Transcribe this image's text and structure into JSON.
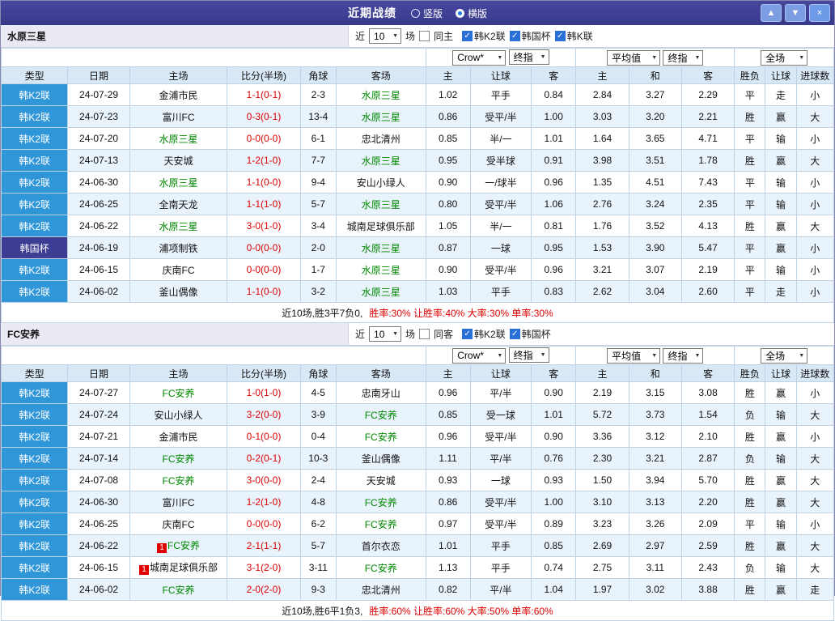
{
  "icons": {
    "chevron_down": "▼",
    "up_arrow": "▲",
    "down_arrow": "▼",
    "close": "×",
    "check": "✓"
  },
  "colors": {
    "win": "#dd0000",
    "draw": "#008800",
    "loss": "#1111cc",
    "k2": "#2f96d8",
    "cup": "#3d3d94",
    "focus": "#008800",
    "score": "#dd0000"
  },
  "result_color_map": {
    "胜": "win",
    "赢": "win",
    "大": "win",
    "平": "draw",
    "走": "draw",
    "负": "loss",
    "输": "loss",
    "小": "loss"
  },
  "titlebar": {
    "title": "近期战绩",
    "radios": [
      {
        "label": "竖版",
        "selected": false
      },
      {
        "label": "横版",
        "selected": true
      }
    ]
  },
  "table_header": {
    "left_columns": [
      "类型",
      "日期",
      "主场",
      "比分(半场)",
      "角球",
      "客场"
    ],
    "asia_sub": [
      "主",
      "让球",
      "客"
    ],
    "euro_sub": [
      "主",
      "和",
      "客"
    ],
    "result_sub": [
      "胜负",
      "让球",
      "进球数"
    ]
  },
  "sections": [
    {
      "team": "水原三星",
      "filters": {
        "near": "近",
        "count": "10",
        "games": "场",
        "same": {
          "label": "同主",
          "checked": false
        },
        "leagues": [
          {
            "label": "韩K2联",
            "checked": true
          },
          {
            "label": "韩国杯",
            "checked": true
          },
          {
            "label": "韩K联",
            "checked": true
          }
        ]
      },
      "dropdowns": {
        "asia_company": "Crow*",
        "asia_time": "终指",
        "euro_company": "平均值",
        "euro_time": "终指",
        "scope": "全场"
      },
      "rows": [
        {
          "league": "韩K2联",
          "date": "24-07-29",
          "home": "金浦市民",
          "home_focus": false,
          "score": "1-1(0-1)",
          "corner": "2-3",
          "away": "水原三星",
          "away_focus": true,
          "asia_home": "1.02",
          "handicap": "平手",
          "asia_away": "0.84",
          "euro_home": "2.84",
          "euro_draw": "3.27",
          "euro_away": "2.29",
          "result": "平",
          "handicap_result": "走",
          "goals": "小"
        },
        {
          "league": "韩K2联",
          "date": "24-07-23",
          "home": "富川FC",
          "home_focus": false,
          "score": "0-3(0-1)",
          "corner": "13-4",
          "away": "水原三星",
          "away_focus": true,
          "asia_home": "0.86",
          "handicap": "受平/半",
          "asia_away": "1.00",
          "euro_home": "3.03",
          "euro_draw": "3.20",
          "euro_away": "2.21",
          "result": "胜",
          "handicap_result": "赢",
          "goals": "大"
        },
        {
          "league": "韩K2联",
          "date": "24-07-20",
          "home": "水原三星",
          "home_focus": true,
          "score": "0-0(0-0)",
          "corner": "6-1",
          "away": "忠北清州",
          "away_focus": false,
          "asia_home": "0.85",
          "handicap": "半/一",
          "asia_away": "1.01",
          "euro_home": "1.64",
          "euro_draw": "3.65",
          "euro_away": "4.71",
          "result": "平",
          "handicap_result": "输",
          "goals": "小"
        },
        {
          "league": "韩K2联",
          "date": "24-07-13",
          "home": "天安城",
          "home_focus": false,
          "score": "1-2(1-0)",
          "corner": "7-7",
          "away": "水原三星",
          "away_focus": true,
          "asia_home": "0.95",
          "handicap": "受半球",
          "asia_away": "0.91",
          "euro_home": "3.98",
          "euro_draw": "3.51",
          "euro_away": "1.78",
          "result": "胜",
          "handicap_result": "赢",
          "goals": "大"
        },
        {
          "league": "韩K2联",
          "date": "24-06-30",
          "home": "水原三星",
          "home_focus": true,
          "score": "1-1(0-0)",
          "corner": "9-4",
          "away": "安山小绿人",
          "away_focus": false,
          "asia_home": "0.90",
          "handicap": "一/球半",
          "asia_away": "0.96",
          "euro_home": "1.35",
          "euro_draw": "4.51",
          "euro_away": "7.43",
          "result": "平",
          "handicap_result": "输",
          "goals": "小"
        },
        {
          "league": "韩K2联",
          "date": "24-06-25",
          "home": "全南天龙",
          "home_focus": false,
          "score": "1-1(1-0)",
          "corner": "5-7",
          "away": "水原三星",
          "away_focus": true,
          "asia_home": "0.80",
          "handicap": "受平/半",
          "asia_away": "1.06",
          "euro_home": "2.76",
          "euro_draw": "3.24",
          "euro_away": "2.35",
          "result": "平",
          "handicap_result": "输",
          "goals": "小"
        },
        {
          "league": "韩K2联",
          "date": "24-06-22",
          "home": "水原三星",
          "home_focus": true,
          "score": "3-0(1-0)",
          "corner": "3-4",
          "away": "城南足球俱乐部",
          "away_focus": false,
          "asia_home": "1.05",
          "handicap": "半/一",
          "asia_away": "0.81",
          "euro_home": "1.76",
          "euro_draw": "3.52",
          "euro_away": "4.13",
          "result": "胜",
          "handicap_result": "赢",
          "goals": "大"
        },
        {
          "league": "韩国杯",
          "is_cup": true,
          "date": "24-06-19",
          "home": "浦项制铁",
          "home_focus": false,
          "score": "0-0(0-0)",
          "corner": "2-0",
          "away": "水原三星",
          "away_focus": true,
          "asia_home": "0.87",
          "handicap": "一球",
          "asia_away": "0.95",
          "euro_home": "1.53",
          "euro_draw": "3.90",
          "euro_away": "5.47",
          "result": "平",
          "handicap_result": "赢",
          "goals": "小"
        },
        {
          "league": "韩K2联",
          "date": "24-06-15",
          "home": "庆南FC",
          "home_focus": false,
          "score": "0-0(0-0)",
          "corner": "1-7",
          "away": "水原三星",
          "away_focus": true,
          "asia_home": "0.90",
          "handicap": "受平/半",
          "asia_away": "0.96",
          "euro_home": "3.21",
          "euro_draw": "3.07",
          "euro_away": "2.19",
          "result": "平",
          "handicap_result": "输",
          "goals": "小"
        },
        {
          "league": "韩K2联",
          "date": "24-06-02",
          "home": "釜山偶像",
          "home_focus": false,
          "score": "1-1(0-0)",
          "corner": "3-2",
          "away": "水原三星",
          "away_focus": true,
          "asia_home": "1.03",
          "handicap": "平手",
          "asia_away": "0.83",
          "euro_home": "2.62",
          "euro_draw": "3.04",
          "euro_away": "2.60",
          "result": "平",
          "handicap_result": "走",
          "goals": "小"
        }
      ],
      "summary": {
        "record": "近10场,胜3平7负0,",
        "rates": "胜率:30% 让胜率:40% 大率:30% 单率:30%"
      }
    },
    {
      "team": "FC安养",
      "filters": {
        "near": "近",
        "count": "10",
        "games": "场",
        "same": {
          "label": "同客",
          "checked": false
        },
        "leagues": [
          {
            "label": "韩K2联",
            "checked": true
          },
          {
            "label": "韩国杯",
            "checked": true
          }
        ]
      },
      "dropdowns": {
        "asia_company": "Crow*",
        "asia_time": "终指",
        "euro_company": "平均值",
        "euro_time": "终指",
        "scope": "全场"
      },
      "rows": [
        {
          "league": "韩K2联",
          "date": "24-07-27",
          "home": "FC安养",
          "home_focus": true,
          "score": "1-0(1-0)",
          "corner": "4-5",
          "away": "忠南牙山",
          "away_focus": false,
          "asia_home": "0.96",
          "handicap": "平/半",
          "asia_away": "0.90",
          "euro_home": "2.19",
          "euro_draw": "3.15",
          "euro_away": "3.08",
          "result": "胜",
          "handicap_result": "赢",
          "goals": "小"
        },
        {
          "league": "韩K2联",
          "date": "24-07-24",
          "home": "安山小绿人",
          "home_focus": false,
          "score": "3-2(0-0)",
          "corner": "3-9",
          "away": "FC安养",
          "away_focus": true,
          "asia_home": "0.85",
          "handicap": "受一球",
          "asia_away": "1.01",
          "euro_home": "5.72",
          "euro_draw": "3.73",
          "euro_away": "1.54",
          "result": "负",
          "handicap_result": "输",
          "goals": "大"
        },
        {
          "league": "韩K2联",
          "date": "24-07-21",
          "home": "金浦市民",
          "home_focus": false,
          "score": "0-1(0-0)",
          "corner": "0-4",
          "away": "FC安养",
          "away_focus": true,
          "asia_home": "0.96",
          "handicap": "受平/半",
          "asia_away": "0.90",
          "euro_home": "3.36",
          "euro_draw": "3.12",
          "euro_away": "2.10",
          "result": "胜",
          "handicap_result": "赢",
          "goals": "小"
        },
        {
          "league": "韩K2联",
          "date": "24-07-14",
          "home": "FC安养",
          "home_focus": true,
          "score": "0-2(0-1)",
          "corner": "10-3",
          "away": "釜山偶像",
          "away_focus": false,
          "asia_home": "1.11",
          "handicap": "平/半",
          "asia_away": "0.76",
          "euro_home": "2.30",
          "euro_draw": "3.21",
          "euro_away": "2.87",
          "result": "负",
          "handicap_result": "输",
          "goals": "大"
        },
        {
          "league": "韩K2联",
          "date": "24-07-08",
          "home": "FC安养",
          "home_focus": true,
          "score": "3-0(0-0)",
          "corner": "2-4",
          "away": "天安城",
          "away_focus": false,
          "asia_home": "0.93",
          "handicap": "一球",
          "asia_away": "0.93",
          "euro_home": "1.50",
          "euro_draw": "3.94",
          "euro_away": "5.70",
          "result": "胜",
          "handicap_result": "赢",
          "goals": "大"
        },
        {
          "league": "韩K2联",
          "date": "24-06-30",
          "home": "富川FC",
          "home_focus": false,
          "score": "1-2(1-0)",
          "corner": "4-8",
          "away": "FC安养",
          "away_focus": true,
          "asia_home": "0.86",
          "handicap": "受平/半",
          "asia_away": "1.00",
          "euro_home": "3.10",
          "euro_draw": "3.13",
          "euro_away": "2.20",
          "result": "胜",
          "handicap_result": "赢",
          "goals": "大"
        },
        {
          "league": "韩K2联",
          "date": "24-06-25",
          "home": "庆南FC",
          "home_focus": false,
          "score": "0-0(0-0)",
          "corner": "6-2",
          "away": "FC安养",
          "away_focus": true,
          "asia_home": "0.97",
          "handicap": "受平/半",
          "asia_away": "0.89",
          "euro_home": "3.23",
          "euro_draw": "3.26",
          "euro_away": "2.09",
          "result": "平",
          "handicap_result": "输",
          "goals": "小"
        },
        {
          "league": "韩K2联",
          "date": "24-06-22",
          "home": "FC安养",
          "home_focus": true,
          "home_badge": "1",
          "score": "2-1(1-1)",
          "corner": "5-7",
          "away": "首尔衣恋",
          "away_focus": false,
          "asia_home": "1.01",
          "handicap": "平手",
          "asia_away": "0.85",
          "euro_home": "2.69",
          "euro_draw": "2.97",
          "euro_away": "2.59",
          "result": "胜",
          "handicap_result": "赢",
          "goals": "大"
        },
        {
          "league": "韩K2联",
          "date": "24-06-15",
          "home": "城南足球俱乐部",
          "home_focus": false,
          "home_badge": "1",
          "score": "3-1(2-0)",
          "corner": "3-11",
          "away": "FC安养",
          "away_focus": true,
          "asia_home": "1.13",
          "handicap": "平手",
          "asia_away": "0.74",
          "euro_home": "2.75",
          "euro_draw": "3.11",
          "euro_away": "2.43",
          "result": "负",
          "handicap_result": "输",
          "goals": "大"
        },
        {
          "league": "韩K2联",
          "date": "24-06-02",
          "home": "FC安养",
          "home_focus": true,
          "score": "2-0(2-0)",
          "corner": "9-3",
          "away": "忠北清州",
          "away_focus": false,
          "asia_home": "0.82",
          "handicap": "平/半",
          "asia_away": "1.04",
          "euro_home": "1.97",
          "euro_draw": "3.02",
          "euro_away": "3.88",
          "result": "胜",
          "handicap_result": "赢",
          "goals": "走"
        }
      ],
      "summary": {
        "record": "近10场,胜6平1负3,",
        "rates": "胜率:60% 让胜率:60% 大率:50% 单率:60%"
      }
    }
  ]
}
